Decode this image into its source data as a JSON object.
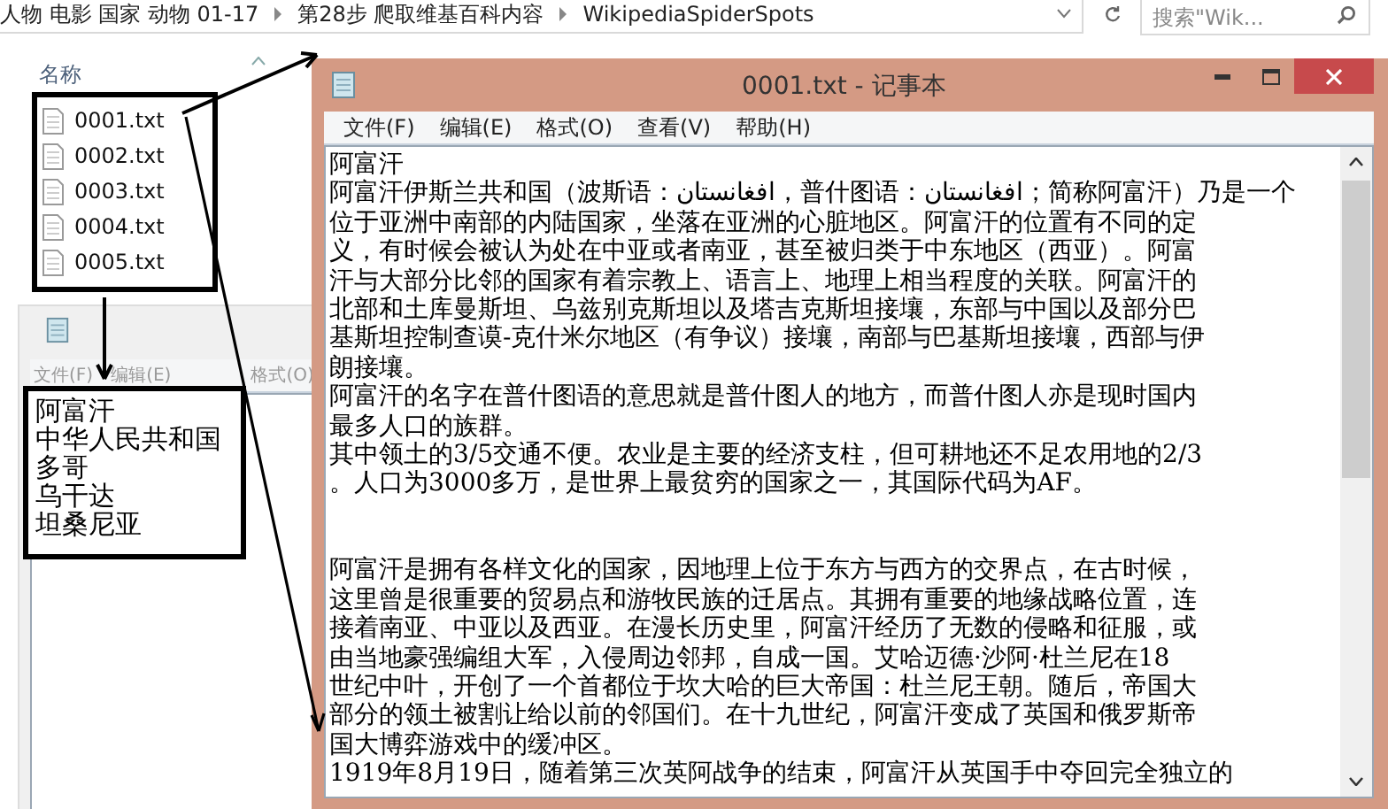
{
  "explorer": {
    "breadcrumb": [
      "人物 电影 国家 动物 01-17",
      "第28步 爬取维基百科内容",
      "WikipediaSpiderSpots"
    ],
    "search": {
      "placeholder": "搜索\"Wik..."
    },
    "column": "名称",
    "files": [
      "0001.txt",
      "0002.txt",
      "0003.txt",
      "0004.txt",
      "0005.txt"
    ]
  },
  "background_notepad": {
    "menu": [
      "文件(F)",
      "编辑(E)",
      "格式(O)"
    ],
    "lines": [
      "阿富汗",
      "中华人民共和国",
      "多哥",
      "乌干达",
      "坦桑尼亚"
    ]
  },
  "notepad": {
    "title": "0001.txt - 记事本",
    "menu": [
      "文件(F)",
      "编辑(E)",
      "格式(O)",
      "查看(V)",
      "帮助(H)"
    ],
    "lines": [
      {
        "kind": "text",
        "text": "阿富汗"
      },
      {
        "kind": "text",
        "text": "阿富汗伊斯兰共和国（波斯语：افغانستان，普什图语：افغانستان；简称阿富汗）乃是一个"
      },
      {
        "kind": "text",
        "text": "位于亚洲中南部的内陆国家，坐落在亚洲的心脏地区。阿富汗的位置有不同的定"
      },
      {
        "kind": "text",
        "text": "义，有时候会被认为处在中亚或者南亚，甚至被归类于中东地区（西亚）。阿富"
      },
      {
        "kind": "text",
        "text": "汗与大部分比邻的国家有着宗教上、语言上、地理上相当程度的关联。阿富汗的"
      },
      {
        "kind": "text",
        "text": "北部和土库曼斯坦、乌兹别克斯坦以及塔吉克斯坦接壤，东部与中国以及部分巴"
      },
      {
        "kind": "text",
        "text": "基斯坦控制查谟-克什米尔地区（有争议）接壤，南部与巴基斯坦接壤，西部与伊"
      },
      {
        "kind": "text",
        "text": "朗接壤。"
      },
      {
        "kind": "text",
        "text": "阿富汗的名字在普什图语的意思就是普什图人的地方，而普什图人亦是现时国内"
      },
      {
        "kind": "text",
        "text": "最多人口的族群。"
      },
      {
        "kind": "text",
        "text": "其中领土的3/5交通不便。农业是主要的经济支柱，但可耕地还不足农用地的2/3"
      },
      {
        "kind": "text",
        "text": "。人口为3000多万，是世界上最贫穷的国家之一，其国际代码为AF。"
      },
      {
        "kind": "blank"
      },
      {
        "kind": "blank"
      },
      {
        "kind": "text",
        "text": "阿富汗是拥有各样文化的国家，因地理上位于东方与西方的交界点，在古时候，"
      },
      {
        "kind": "text",
        "text": "这里曾是很重要的贸易点和游牧民族的迁居点。其拥有重要的地缘战略位置，连"
      },
      {
        "kind": "text",
        "text": "接着南亚、中亚以及西亚。在漫长历史里，阿富汗经历了无数的侵略和征服，或"
      },
      {
        "kind": "text",
        "text": "由当地豪强编组大军，入侵周边邻邦，自成一国。艾哈迈德·沙阿·杜兰尼在18"
      },
      {
        "kind": "text",
        "text": "世纪中叶，开创了一个首都位于坎大哈的巨大帝国：杜兰尼王朝。随后，帝国大"
      },
      {
        "kind": "text",
        "text": "部分的领土被割让给以前的邻国们。在十九世纪，阿富汗变成了英国和俄罗斯帝"
      },
      {
        "kind": "text",
        "text": "国大博弈游戏中的缓冲区。"
      },
      {
        "kind": "text",
        "text": "1919年8月19日，随着第三次英阿战争的结束，阿富汗从英国手中夺回完全独立的"
      }
    ]
  }
}
